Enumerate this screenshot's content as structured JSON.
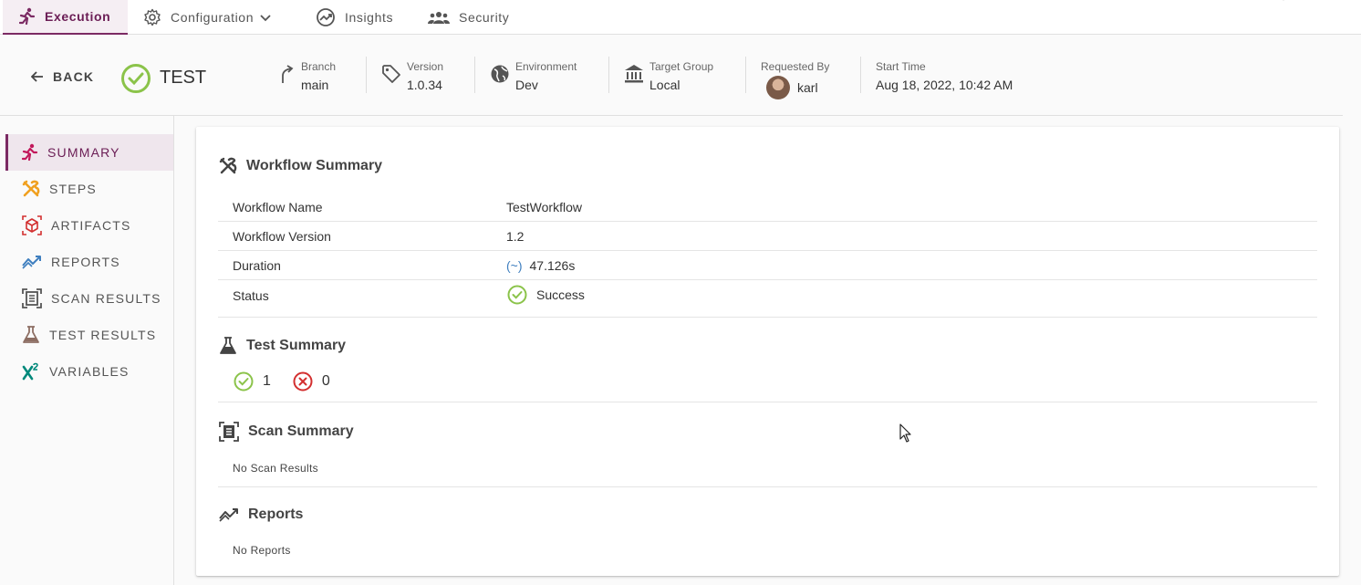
{
  "topnav": {
    "tabs": [
      {
        "label": "Execution",
        "icon": "run-icon",
        "active": true
      },
      {
        "label": "Configuration",
        "icon": "gear-icon"
      },
      {
        "label": "Insights",
        "icon": "insights-icon"
      },
      {
        "label": "Security",
        "icon": "group-icon"
      }
    ]
  },
  "header": {
    "back_label": "BACK",
    "execution_name": "TEST",
    "branch": {
      "label": "Branch",
      "value": "main"
    },
    "version": {
      "label": "Version",
      "value": "1.0.34"
    },
    "environment": {
      "label": "Environment",
      "value": "Dev"
    },
    "target_group": {
      "label": "Target Group",
      "value": "Local"
    },
    "requested_by": {
      "label": "Requested By",
      "value": "karl"
    },
    "start_time": {
      "label": "Start Time",
      "value": "Aug 18, 2022, 10:42 AM"
    }
  },
  "sidebar": {
    "items": [
      {
        "label": "SUMMARY",
        "icon": "run-icon",
        "active": true
      },
      {
        "label": "STEPS",
        "icon": "tools-icon"
      },
      {
        "label": "ARTIFACTS",
        "icon": "package-icon"
      },
      {
        "label": "REPORTS",
        "icon": "trend-icon"
      },
      {
        "label": "SCAN RESULTS",
        "icon": "scan-icon"
      },
      {
        "label": "TEST RESULTS",
        "icon": "flask-icon"
      },
      {
        "label": "VARIABLES",
        "icon": "variable-icon"
      }
    ]
  },
  "workflow_summary": {
    "title": "Workflow Summary",
    "rows": [
      {
        "key": "Workflow Name",
        "value": "TestWorkflow"
      },
      {
        "key": "Workflow Version",
        "value": "1.2"
      },
      {
        "key": "Duration",
        "value": "47.126s",
        "prefix": "(~)"
      },
      {
        "key": "Status",
        "value": "Success"
      }
    ]
  },
  "test_summary": {
    "title": "Test Summary",
    "passed": "1",
    "failed": "0"
  },
  "scan_summary": {
    "title": "Scan Summary",
    "empty_text": "No Scan Results"
  },
  "reports": {
    "title": "Reports",
    "empty_text": "No Reports"
  },
  "colors": {
    "accent": "#7b2a63",
    "success": "#8bc34a",
    "failure": "#d32f2f",
    "steps_orange": "#f0a020",
    "reports_blue": "#3f7fbf",
    "variables_teal": "#00897b"
  }
}
